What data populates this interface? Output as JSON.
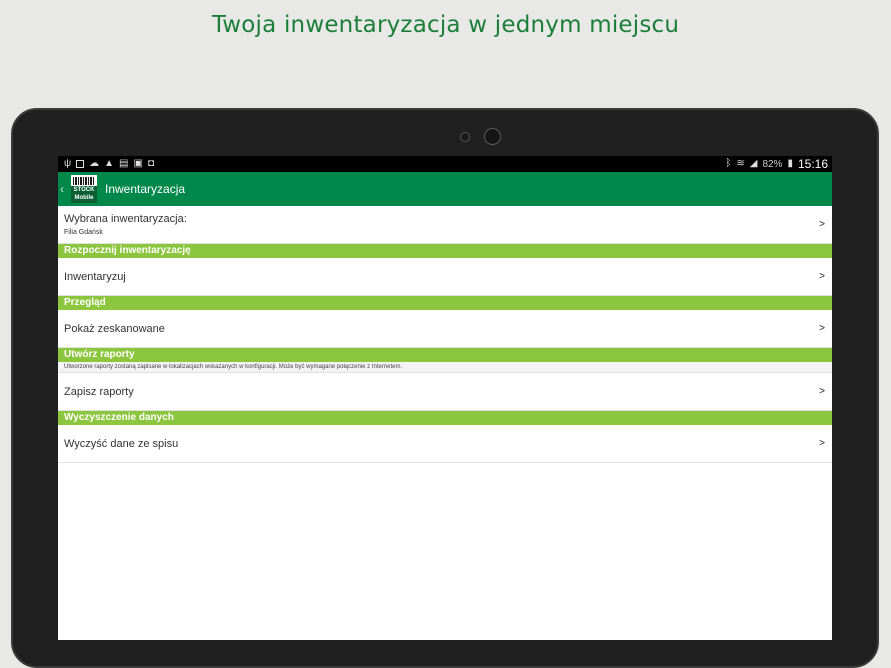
{
  "headline": "Twoja inwentaryzacja w jednym miejscu",
  "status_bar": {
    "left_icons": [
      "usb-icon",
      "image-icon",
      "cloud-icon",
      "warning-icon",
      "document-icon",
      "briefcase-icon",
      "camera-icon"
    ],
    "right_icons": [
      "bluetooth-icon",
      "wifi-icon",
      "signal-icon",
      "battery-icon"
    ],
    "battery": "82%",
    "time": "15:16"
  },
  "app_bar": {
    "logo_top": "STOCK",
    "logo_bottom": "Mobile",
    "title": "Inwentaryzacja"
  },
  "selected": {
    "label": "Wybrana inwentaryzacja:",
    "value": "Filia Gdańsk",
    "chevron": ">"
  },
  "sections": {
    "start": {
      "header": "Rozpocznij inwentaryzację",
      "item": "Inwentaryzuj",
      "chevron": ">"
    },
    "review": {
      "header": "Przegląd",
      "item": "Pokaż zeskanowane",
      "chevron": ">"
    },
    "reports": {
      "header": "Utwórz raporty",
      "note": "Utworzone raporty zostaną zapisane w lokalizacjach wskazanych w konfiguracji. Może być wymagane połączenie z Internetem.",
      "item": "Zapisz raporty",
      "chevron": ">"
    },
    "clear": {
      "header": "Wyczyszczenie danych",
      "item": "Wyczyść dane ze spisu",
      "chevron": ">"
    }
  },
  "colors": {
    "brand_green": "#00884a",
    "section_green": "#8cc63f",
    "headline_green": "#1b7f3a"
  }
}
